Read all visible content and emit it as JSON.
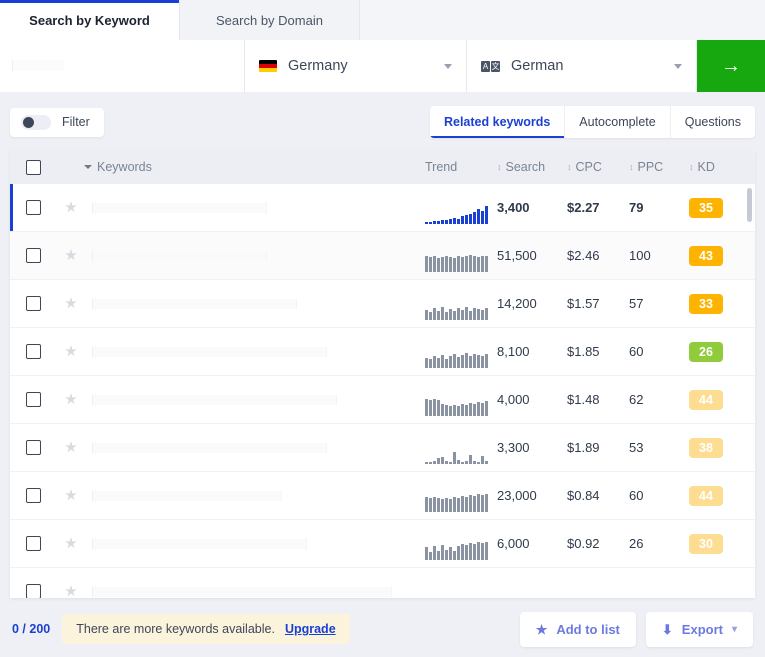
{
  "top": {
    "tabs": [
      {
        "label": "Search by Keyword",
        "active": true
      },
      {
        "label": "Search by Domain",
        "active": false
      }
    ],
    "keyword_input": {
      "value": "",
      "placeholder": ""
    },
    "country_select": {
      "value": "Germany",
      "icon": "flag-germany-icon"
    },
    "language_select": {
      "value": "German",
      "icon": "translate-icon",
      "glyph_a": "A",
      "glyph_b": "文"
    },
    "search_button": {
      "icon": "arrow-right-icon",
      "glyph": "→",
      "color": "#17a810"
    }
  },
  "controls": {
    "filter_label": "Filter",
    "filter_enabled": false,
    "subtabs": [
      {
        "label": "Related keywords",
        "active": true
      },
      {
        "label": "Autocomplete",
        "active": false
      },
      {
        "label": "Questions",
        "active": false
      }
    ],
    "accent_color": "#1a3fd4"
  },
  "table": {
    "columns": {
      "keywords": "Keywords",
      "trend": "Trend",
      "search": "Search",
      "cpc": "CPC",
      "ppc": "PPC",
      "kd": "KD"
    },
    "sort_glyph": "↕",
    "rows": [
      {
        "keyword": "",
        "search": "3,400",
        "cpc": "$2.27",
        "ppc": "79",
        "kd": "35",
        "kd_style": "orange",
        "trend": [
          2,
          2,
          3,
          3,
          4,
          4,
          5,
          6,
          5,
          8,
          9,
          10,
          12,
          15,
          13,
          18
        ],
        "trend_color": "#1a3fd4",
        "selected": true,
        "highlight": false,
        "kw_width": 175
      },
      {
        "keyword": "",
        "search": "51,500",
        "cpc": "$2.46",
        "ppc": "100",
        "kd": "43",
        "kd_style": "orange",
        "trend": [
          16,
          15,
          16,
          14,
          15,
          16,
          15,
          14,
          16,
          15,
          16,
          17,
          16,
          15,
          16,
          16
        ],
        "trend_color": "#8b93a3",
        "selected": false,
        "highlight": true,
        "kw_width": 175
      },
      {
        "keyword": "",
        "search": "14,200",
        "cpc": "$1.57",
        "ppc": "57",
        "kd": "33",
        "kd_style": "orange",
        "trend": [
          10,
          8,
          12,
          9,
          13,
          8,
          11,
          9,
          12,
          10,
          13,
          9,
          12,
          11,
          10,
          12
        ],
        "trend_color": "#8b93a3",
        "selected": false,
        "highlight": false,
        "kw_width": 205
      },
      {
        "keyword": "",
        "search": "8,100",
        "cpc": "$1.85",
        "ppc": "60",
        "kd": "26",
        "kd_style": "green",
        "trend": [
          10,
          9,
          12,
          10,
          13,
          9,
          12,
          14,
          11,
          13,
          15,
          12,
          14,
          13,
          12,
          14
        ],
        "trend_color": "#8b93a3",
        "selected": false,
        "highlight": false,
        "kw_width": 235
      },
      {
        "keyword": "",
        "search": "4,000",
        "cpc": "$1.48",
        "ppc": "62",
        "kd": "44",
        "kd_style": "faded",
        "trend": [
          17,
          16,
          17,
          16,
          12,
          11,
          10,
          11,
          10,
          12,
          11,
          13,
          12,
          14,
          13,
          15
        ],
        "trend_color": "#8b93a3",
        "selected": false,
        "highlight": false,
        "kw_width": 245
      },
      {
        "keyword": "",
        "search": "3,300",
        "cpc": "$1.89",
        "ppc": "53",
        "kd": "38",
        "kd_style": "faded",
        "trend": [
          2,
          2,
          3,
          6,
          7,
          3,
          2,
          12,
          4,
          2,
          3,
          9,
          3,
          2,
          8,
          3
        ],
        "trend_color": "#8b93a3",
        "selected": false,
        "highlight": false,
        "kw_width": 235
      },
      {
        "keyword": "",
        "search": "23,000",
        "cpc": "$0.84",
        "ppc": "60",
        "kd": "44",
        "kd_style": "faded",
        "trend": [
          15,
          14,
          15,
          14,
          13,
          14,
          13,
          15,
          14,
          16,
          15,
          17,
          16,
          18,
          17,
          18
        ],
        "trend_color": "#8b93a3",
        "selected": false,
        "highlight": false,
        "kw_width": 190
      },
      {
        "keyword": "",
        "search": "6,000",
        "cpc": "$0.92",
        "ppc": "26",
        "kd": "30",
        "kd_style": "faded",
        "trend": [
          13,
          8,
          14,
          9,
          15,
          10,
          13,
          9,
          14,
          16,
          15,
          17,
          16,
          18,
          17,
          18
        ],
        "trend_color": "#8b93a3",
        "selected": false,
        "highlight": false,
        "kw_width": 215
      },
      {
        "keyword": "",
        "search": "",
        "cpc": "",
        "ppc": "",
        "kd": "",
        "kd_style": "faded",
        "trend": [],
        "trend_color": "#8b93a3",
        "selected": false,
        "highlight": false,
        "kw_width": 300
      }
    ]
  },
  "bottom": {
    "counter": "0 / 200",
    "upgrade_message": "There are more keywords available.",
    "upgrade_link": "Upgrade",
    "add_to_list_label": "Add to list",
    "add_to_list_icon": "star-icon",
    "export_label": "Export",
    "export_icon": "download-icon",
    "export_chevron": "⌄"
  }
}
